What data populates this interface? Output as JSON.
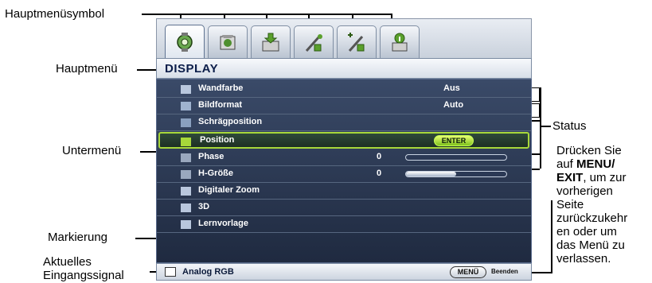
{
  "callouts": {
    "main_menu_icon": "Hauptmenüsymbol",
    "main_menu": "Hauptmenü",
    "submenu": "Untermenü",
    "highlight": "Markierung",
    "current_input_line1": "Aktuelles",
    "current_input_line2": "Eingangssignal",
    "status": "Status",
    "hint_1": "Drücken Sie",
    "hint_2_prefix": "auf ",
    "hint_2_bold": "MENU/",
    "hint_3_bold": "EXIT",
    "hint_3_suffix": ", um zur",
    "hint_4": "vorherigen",
    "hint_5": "Seite",
    "hint_6": "zurückzukehr",
    "hint_7": "en oder um",
    "hint_8": "das Menü zu",
    "hint_9": "verlassen."
  },
  "osd": {
    "tabs": [
      {
        "icon": "display-tab-icon",
        "active": true
      },
      {
        "icon": "picture-tab-icon",
        "active": false
      },
      {
        "icon": "source-tab-icon",
        "active": false
      },
      {
        "icon": "system-setup-basic-tab-icon",
        "active": false
      },
      {
        "icon": "system-setup-advanced-tab-icon",
        "active": false
      },
      {
        "icon": "information-tab-icon",
        "active": false
      }
    ],
    "title": "DISPLAY",
    "items": [
      {
        "label": "Wandfarbe",
        "value": "Aus",
        "icon": "wall-color-icon"
      },
      {
        "label": "Bildformat",
        "value": "Auto",
        "icon": "aspect-ratio-icon"
      },
      {
        "label": "Schrägposition",
        "value": "",
        "icon": "keystone-icon"
      },
      {
        "label": "Position",
        "value": "ENTER",
        "icon": "position-icon"
      },
      {
        "label": "Phase",
        "value": "0",
        "level": 0.0,
        "icon": "phase-icon"
      },
      {
        "label": "H-Größe",
        "value": "0",
        "level": 0.5,
        "icon": "h-size-icon"
      },
      {
        "label": "Digitaler Zoom",
        "value": "",
        "icon": "digital-zoom-icon"
      },
      {
        "label": "3D",
        "value": "",
        "icon": "3d-icon"
      },
      {
        "label": "Lernvorlage",
        "value": "",
        "icon": "teaching-template-icon"
      }
    ],
    "source": "Analog RGB",
    "menu_button": "MENÜ",
    "exit_label": "Beenden",
    "colors": {
      "accent": "#a8d83a",
      "panel": "#2a3753"
    }
  }
}
